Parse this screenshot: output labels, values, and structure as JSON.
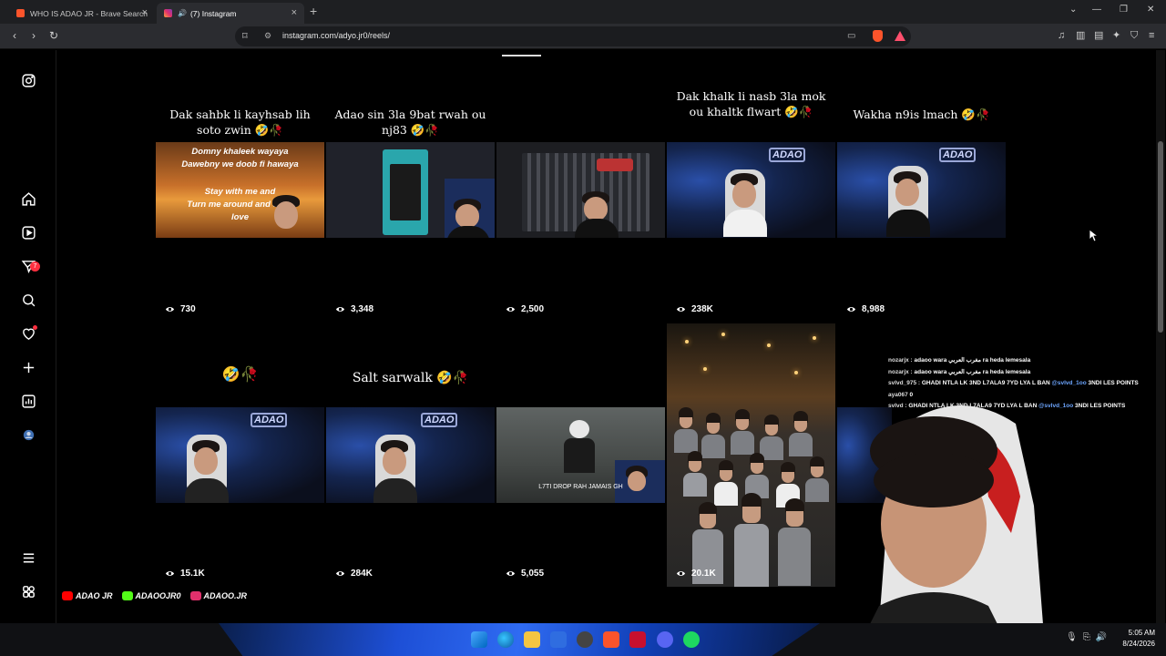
{
  "browser": {
    "tabs": [
      {
        "title": "WHO IS ADAO JR - Brave Search",
        "active": false
      },
      {
        "title": "(7) Instagram",
        "active": true
      }
    ],
    "url": "instagram.com/adyo.jr0/reels/",
    "accent": "#fb542b"
  },
  "sidebar": {
    "items": [
      {
        "name": "instagram-logo-icon"
      },
      {
        "name": "home-icon"
      },
      {
        "name": "reels-icon"
      },
      {
        "name": "messages-icon",
        "badge": "7"
      },
      {
        "name": "search-icon"
      },
      {
        "name": "notifications-heart-icon"
      },
      {
        "name": "create-plus-icon"
      },
      {
        "name": "dashboard-icon"
      },
      {
        "name": "profile-avatar"
      },
      {
        "name": "more-menu-icon"
      },
      {
        "name": "also-from-meta-icon"
      }
    ]
  },
  "reels": [
    {
      "caption": "Dak sahbk li kayhsab lih soto zwin 🤣🥀",
      "views": "730",
      "thumb": "sunset",
      "lyrics": [
        "Domny khaleek wayaya",
        "Dawebny we doob fi hawaya",
        "",
        "Stay with me and",
        "Turn me around and d   my",
        "love"
      ]
    },
    {
      "caption": "Adao sin 3la 9bat rwah ou nj83 🤣🥀",
      "views": "3,348",
      "thumb": "desk-phone"
    },
    {
      "caption": "",
      "views": "2,500",
      "thumb": "desk-icons"
    },
    {
      "caption": "Dak khalk li nasb 3la mok ou khaltk flwart 🤣🥀",
      "views": "238K",
      "thumb": "blue-room"
    },
    {
      "caption": "Wakha n9is lmach 🤣🥀",
      "views": "8,988",
      "thumb": "blue-room-2"
    },
    {
      "caption": "🤣🥀",
      "views": "15.1K",
      "thumb": "blue-room-3"
    },
    {
      "caption": "Salt sarwalk 🤣🥀",
      "views": "284K",
      "thumb": "blue-room-4"
    },
    {
      "caption": "",
      "views": "5,055",
      "thumb": "game",
      "overlay_text": "L7TI DROP RAH JAMAIS GH"
    },
    {
      "caption": "",
      "views": "20.1K",
      "thumb": "group-photo"
    }
  ],
  "chat": [
    {
      "user": "nozarjx :",
      "msg": "adaoo wara مغرب العربي ra heda lemesala"
    },
    {
      "user": "nozarjx :",
      "msg": "adaoo wara مغرب العربي ra heda lemesala"
    },
    {
      "user": "svlvd_975 :",
      "msg": "GHADI NTLA LK 3ND L7ALA9 7YD LYA L BAN",
      "mention": "@svlvd_1oo",
      "tail": "3NDI LES POINTS"
    },
    {
      "user": "aya067",
      "msg": "0"
    },
    {
      "user": "svlvd :",
      "msg": "GHADI NTLA LK 3ND L7ALA9 7YD LYA L BAN",
      "mention": "@svlvd_1oo",
      "tail": "3NDI LES POINTS"
    }
  ],
  "socials": [
    {
      "label": "ADAO JR",
      "color": "#ff0000"
    },
    {
      "label": "ADAOOJR0",
      "color": "#53fc18"
    },
    {
      "label": "ADAOO.JR",
      "color": "#e1306c"
    }
  ],
  "taskbar": {
    "time": "5:05 AM",
    "date": "8/24/2026"
  }
}
